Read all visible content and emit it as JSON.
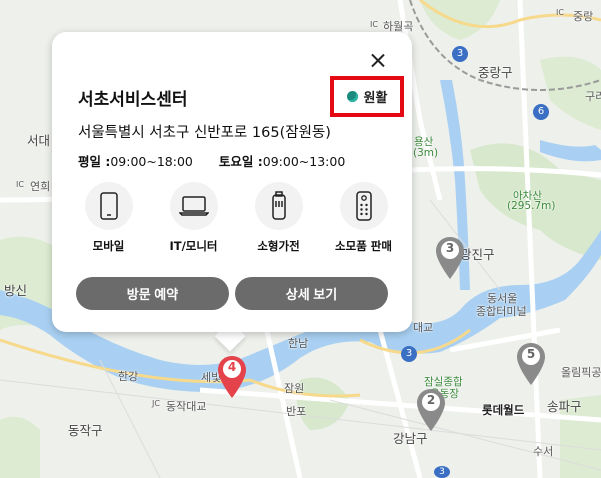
{
  "map": {
    "labels": {
      "l1": "하월곡",
      "l2": "중랑",
      "l3": "중랑구",
      "l4": "구리",
      "l5": "서대",
      "l6": "연희",
      "l7": "아차산",
      "l8": "(295.7m)",
      "l9": "용산",
      "l10": "(3m)",
      "l11": "광진구",
      "l12": "동서울",
      "l13": "종합터미널",
      "l14": "방신",
      "l15": "대교",
      "l16": "한남",
      "l17": "한강",
      "l18": "잠원",
      "l19": "동작대교",
      "l20": "반포",
      "l21": "잠실종합",
      "l22": "운동장",
      "l23": "올림픽공",
      "l24": "롯데월드",
      "l25": "송파구",
      "l26": "동작구",
      "l27": "강남구",
      "l28": "수서",
      "l29": "세빛",
      "l30": "IC",
      "l31": "IC",
      "l32": "IC",
      "l33": "JC"
    },
    "pins": [
      {
        "num": "4",
        "color": "#e5434b"
      },
      {
        "num": "3",
        "color": "#8a8a8a"
      },
      {
        "num": "2",
        "color": "#8a8a8a"
      },
      {
        "num": "5",
        "color": "#8a8a8a"
      }
    ],
    "route_numbers": [
      "3",
      "6",
      "3",
      "3"
    ]
  },
  "popup": {
    "name": "서초서비스센터",
    "status": "원활",
    "status_color": "#1a8a7e",
    "address": "서울특별시 서초구 신반포로 165(잠원동)",
    "weekday_label": "평일 :",
    "weekday_hours": "09:00~18:00",
    "saturday_label": "토요일 :",
    "saturday_hours": "09:00~13:00",
    "services": [
      {
        "label": "모바일",
        "icon": "mobile-phone-icon"
      },
      {
        "label": "IT/모니터",
        "icon": "laptop-icon"
      },
      {
        "label": "소형가전",
        "icon": "small-appliance-icon"
      },
      {
        "label": "소모품 판매",
        "icon": "remote-control-icon"
      }
    ],
    "reserve_label": "방문 예약",
    "detail_label": "상세 보기"
  },
  "colors": {
    "highlight": "#e50914",
    "button": "#6b6b6b",
    "active_pin": "#e5434b"
  }
}
